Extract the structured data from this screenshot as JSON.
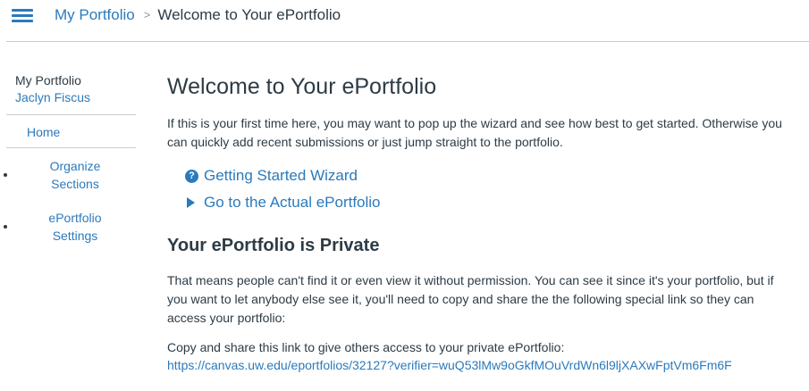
{
  "header": {
    "breadcrumb_root": "My Portfolio",
    "breadcrumb_separator": ">",
    "breadcrumb_current": "Welcome to Your ePortfolio",
    "menu_icon": "hamburger-icon"
  },
  "sidebar": {
    "title": "My Portfolio",
    "user": "Jaclyn Fiscus",
    "home": "Home",
    "organize": "Organize Sections",
    "settings": "ePortfolio Settings"
  },
  "main": {
    "title": "Welcome to Your ePortfolio",
    "intro": "If this is your first time here, you may want to pop up the wizard and see how best to get started. Otherwise you can quickly add recent submissions or just jump straight to the portfolio.",
    "wizard_label": "Getting Started Wizard",
    "wizard_icon_glyph": "?",
    "portfolio_label": "Go to the Actual ePortfolio",
    "private_title": "Your ePortfolio is Private",
    "private_text": "That means people can't find it or even view it without permission. You can see it since it's your portfolio, but if you want to let anybody else see it, you'll need to copy and share the the following special link so they can access your portfolio:",
    "share_label": "Copy and share this link to give others access to your private ePortfolio:",
    "share_link": "https://canvas.uw.edu/eportfolios/32127?verifier=wuQ53lMw9oGkfMOuVrdWn6l9ljXAXwFptVm6Fm6F"
  },
  "colors": {
    "link": "#2b7abc",
    "text": "#2d3b45",
    "divider": "#c7cdd1"
  }
}
